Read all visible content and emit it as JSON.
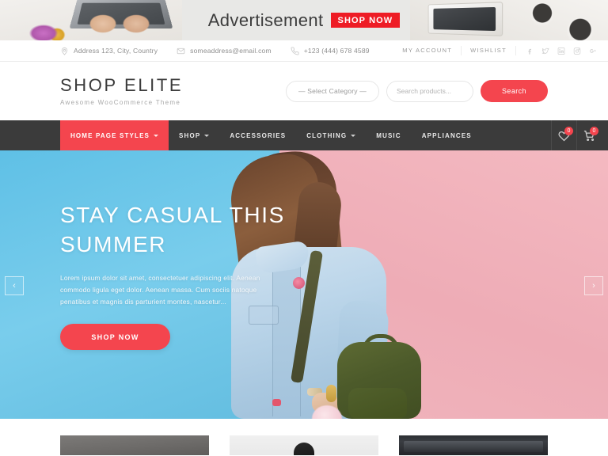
{
  "ad": {
    "text": "Advertisement",
    "badge_label": "SHOP NOW"
  },
  "topbar": {
    "address": "Address 123, City, Country",
    "email": "someaddress@email.com",
    "phone": "+123 (444) 678 4589",
    "my_account": "MY ACCOUNT",
    "wishlist": "WISHLIST",
    "social": [
      {
        "name": "facebook-icon"
      },
      {
        "name": "twitter-icon"
      },
      {
        "name": "linkedin-icon"
      },
      {
        "name": "instagram-icon"
      },
      {
        "name": "googleplus-icon"
      }
    ]
  },
  "header": {
    "logo_title": "SHOP ELITE",
    "logo_subtitle": "Awesome WooCommerce Theme",
    "category_select": "— Select Category —",
    "search_placeholder": "Search products...",
    "search_button": "Search"
  },
  "nav": {
    "items": [
      {
        "label": "HOME PAGE STYLES",
        "has_dropdown": true,
        "active": true
      },
      {
        "label": "SHOP",
        "has_dropdown": true,
        "active": false
      },
      {
        "label": "ACCESSORIES",
        "has_dropdown": false,
        "active": false
      },
      {
        "label": "CLOTHING",
        "has_dropdown": true,
        "active": false
      },
      {
        "label": "MUSIC",
        "has_dropdown": false,
        "active": false
      },
      {
        "label": "APPLIANCES",
        "has_dropdown": false,
        "active": false
      }
    ],
    "wishlist_count": "0",
    "cart_count": "0"
  },
  "hero": {
    "heading": "STAY CASUAL THIS SUMMER",
    "paragraph": "Lorem ipsum dolor sit amet, consectetuer adipiscing elit. Aenean commodo ligula eget dolor. Aenean massa. Cum sociis natoque penatibus et magnis dis parturient montes, nascetur...",
    "button_label": "SHOP NOW",
    "prev_arrow": "‹",
    "next_arrow": "›"
  },
  "colors": {
    "accent": "#f4454e",
    "nav_background": "#3b3b3b",
    "hero_blue": "#63c3e8",
    "hero_pink": "#f0b4bc",
    "ad_badge": "#ee1c25"
  }
}
